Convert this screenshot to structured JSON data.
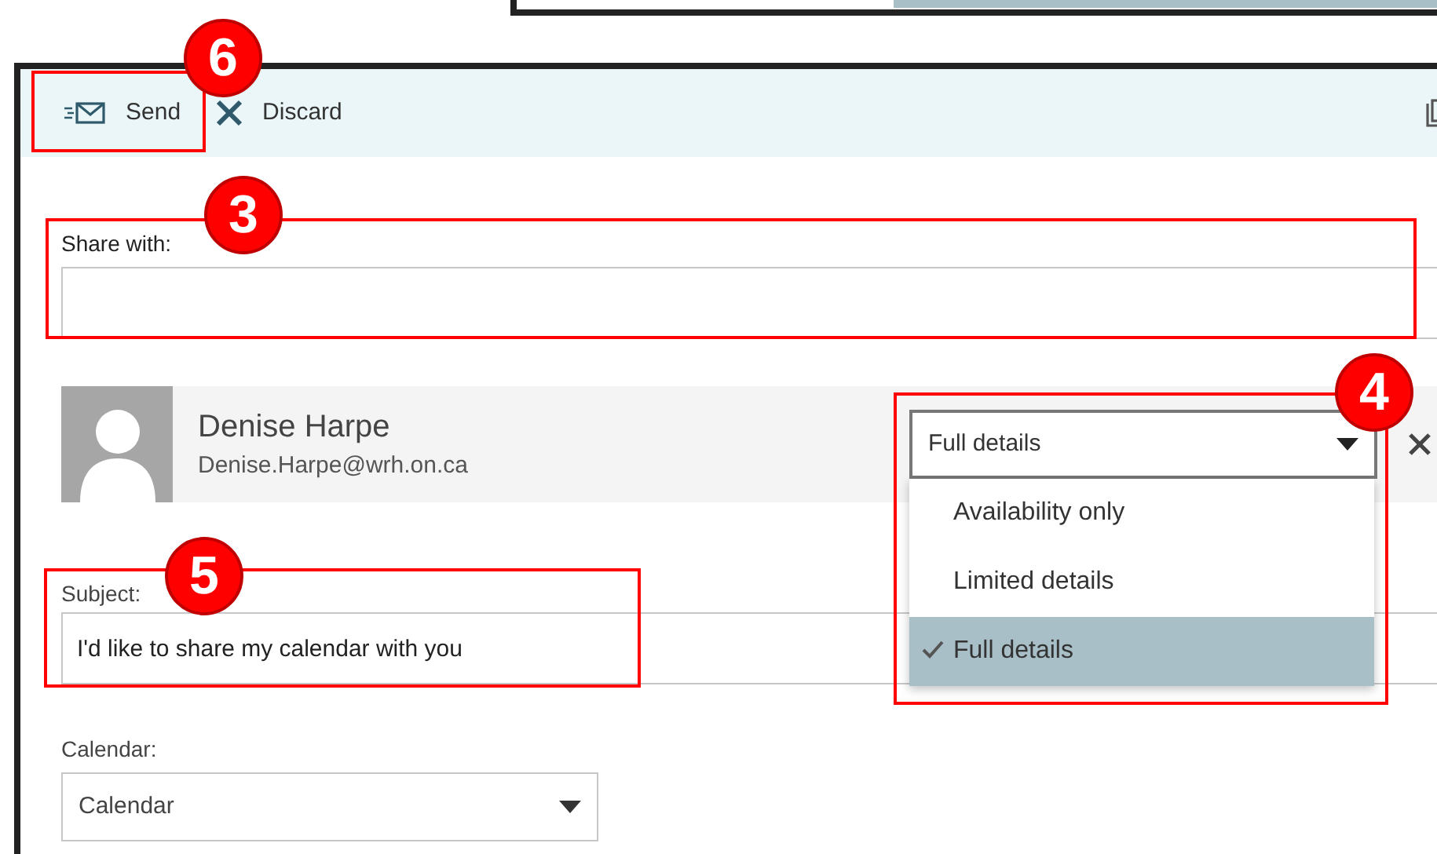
{
  "toolbar": {
    "buttons": [
      {
        "kind": "send",
        "label": "Send"
      },
      {
        "kind": "discard",
        "label": "Discard"
      }
    ]
  },
  "share_with": {
    "label": "Share with:"
  },
  "recipient": {
    "name": "Denise Harpe",
    "email": "Denise.Harpe@wrh.on.ca",
    "permission": "Full details",
    "menu_expanded": true,
    "options": [
      {
        "label": "Availability only",
        "selected": false
      },
      {
        "label": "Limited details",
        "selected": false
      },
      {
        "label": "Full details",
        "selected": true
      }
    ]
  },
  "subject": {
    "label": "Subject:",
    "value": "I'd like to share my calendar with you"
  },
  "calendar": {
    "label": "Calendar:",
    "value": "Calendar"
  },
  "annotations": [
    {
      "number": "6"
    },
    {
      "number": "3"
    },
    {
      "number": "4"
    },
    {
      "number": "5"
    }
  ]
}
